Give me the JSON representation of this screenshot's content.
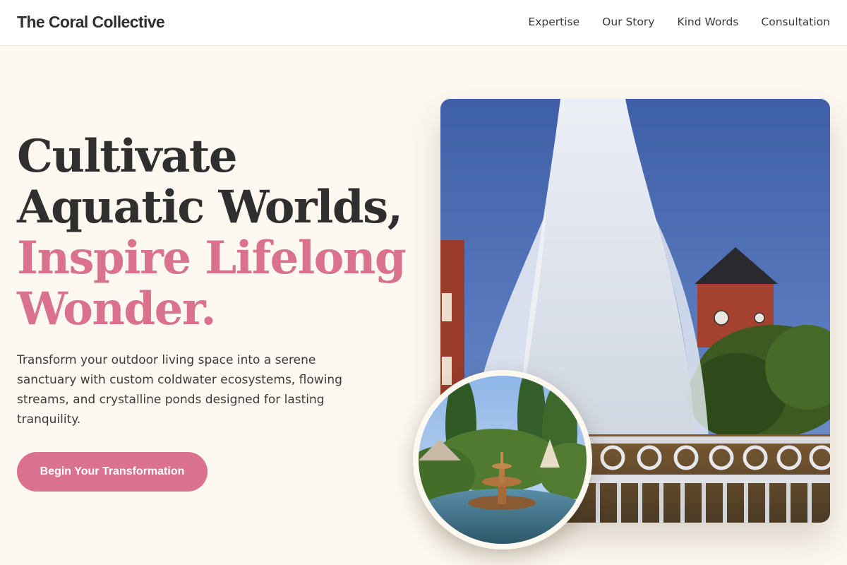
{
  "brand": {
    "name": "The Coral Collective"
  },
  "nav": {
    "items": [
      {
        "label": "Expertise"
      },
      {
        "label": "Our Story"
      },
      {
        "label": "Kind Words"
      },
      {
        "label": "Consultation"
      }
    ]
  },
  "hero": {
    "headline_line1": "Cultivate",
    "headline_line2": "Aquatic Worlds,",
    "headline_line3": "Inspire Lifelong",
    "headline_line4": "Wonder.",
    "intro": "Transform your outdoor living space into a serene sanctuary with custom coldwater ecosystems, flowing streams, and crystalline ponds designed for lasting tranquility.",
    "cta_label": "Begin Your Transformation"
  },
  "colors": {
    "accent": "#d9718f",
    "page_background": "#fdf9f0",
    "header_background": "#ffffff",
    "heading_text": "#2f2f2f"
  }
}
